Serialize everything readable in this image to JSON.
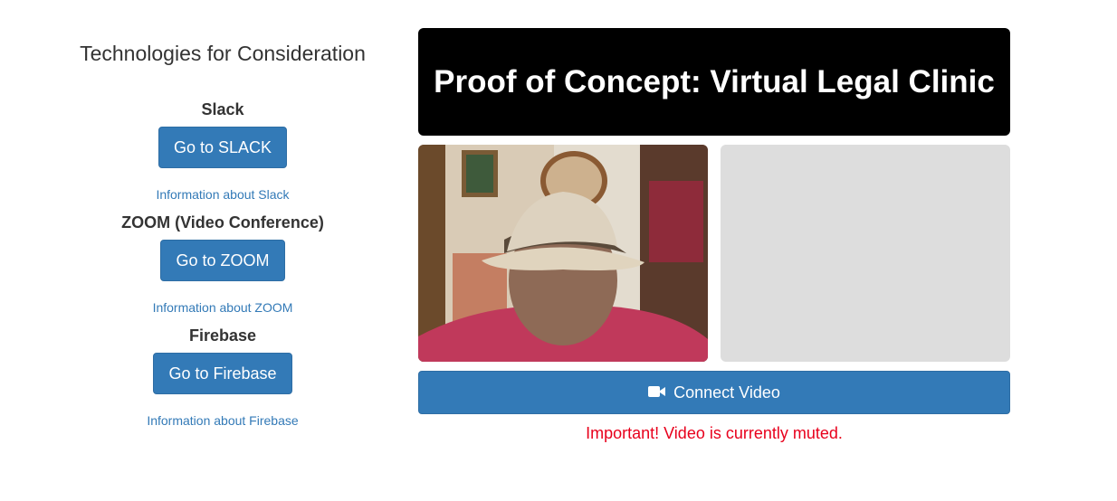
{
  "sidebar": {
    "title": "Technologies for Consideration",
    "items": [
      {
        "name": "Slack",
        "button": "Go to SLACK",
        "link": "Information about Slack"
      },
      {
        "name": "ZOOM (Video Conference)",
        "button": "Go to ZOOM",
        "link": "Information about ZOOM"
      },
      {
        "name": "Firebase",
        "button": "Go to Firebase",
        "link": "Information about Firebase"
      }
    ]
  },
  "main": {
    "banner_title": "Proof of Concept: Virtual Legal Clinic",
    "connect_label": "Connect Video",
    "connect_icon": "video-camera-icon",
    "mute_warning": "Important! Video is currently muted."
  },
  "colors": {
    "primary": "#337ab7",
    "banner_bg": "#000000",
    "warning": "#e8001c",
    "remote_placeholder": "#dddddd"
  }
}
